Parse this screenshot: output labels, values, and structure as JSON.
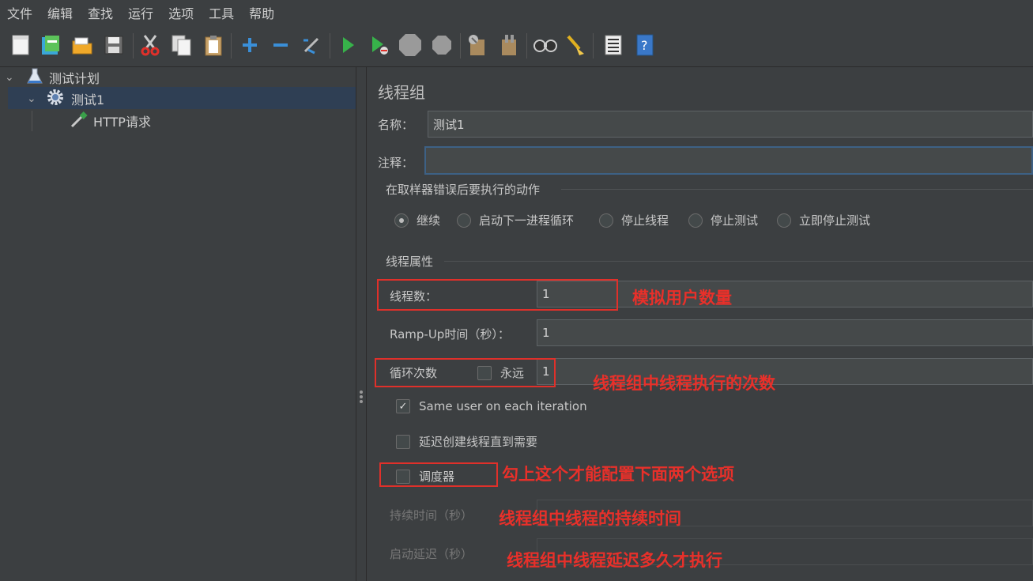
{
  "menu": [
    "文件",
    "编辑",
    "查找",
    "运行",
    "选项",
    "工具",
    "帮助"
  ],
  "toolbar_icons": [
    "new-icon",
    "templates-icon",
    "open-icon",
    "save-icon",
    "cut-icon",
    "copy-icon",
    "paste-icon",
    "expand-icon",
    "collapse-icon",
    "toggle-icon",
    "start-icon",
    "start-no-pause-icon",
    "stop-icon",
    "shutdown-icon",
    "clear-icon",
    "clear-all-icon",
    "search-icon",
    "reset-search-icon",
    "function-helper-icon",
    "help-icon"
  ],
  "tree": {
    "root": "测试计划",
    "thread_group": "测试1",
    "sampler": "HTTP请求"
  },
  "panel": {
    "title": "线程组",
    "name_label": "名称：",
    "name_value": "测试1",
    "comment_label": "注释：",
    "comment_value": "",
    "error_section": "在取样器错误后要执行的动作",
    "error_actions": [
      "继续",
      "启动下一进程循环",
      "停止线程",
      "停止测试",
      "立即停止测试"
    ],
    "error_selected": "继续",
    "props_section": "线程属性",
    "threads_label": "线程数：",
    "threads_value": "1",
    "rampup_label": "Ramp-Up时间（秒）：",
    "rampup_value": "1",
    "loop_label": "循环次数",
    "forever_label": "永远",
    "loop_value": "1",
    "same_user_label": "Same user on each iteration",
    "same_user_checked": true,
    "delay_create_label": "延迟创建线程直到需要",
    "scheduler_label": "调度器",
    "duration_label": "持续时间（秒）",
    "startup_delay_label": "启动延迟（秒）"
  },
  "annotations": {
    "threads": "模拟用户数量",
    "loops": "线程组中线程执行的次数",
    "scheduler": "勾上这个才能配置下面两个选项",
    "duration": "线程组中线程的持续时间",
    "delay": "线程组中线程延迟多久才执行"
  },
  "colors": {
    "annotation_red": "#e8302a",
    "selection": "#2f3f54",
    "focus_border": "#3d6185"
  }
}
